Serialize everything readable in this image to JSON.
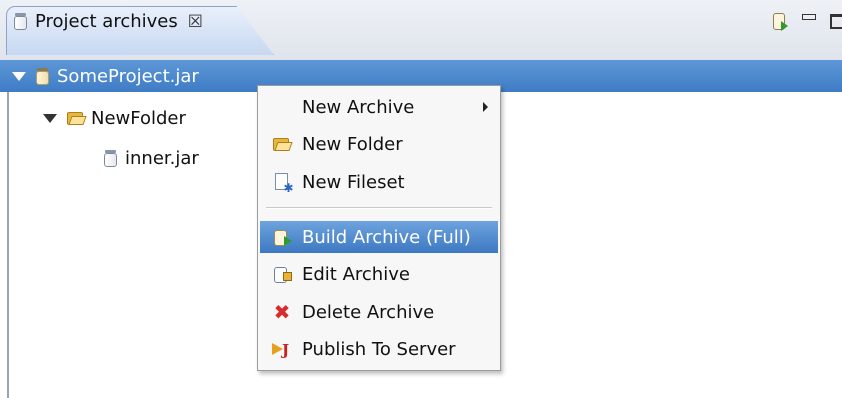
{
  "view": {
    "tab_title": "Project archives",
    "tab_close_glyph": "☒",
    "tab_icon": "jar-icon",
    "toolbar_icons": [
      "build-archive-icon",
      "minimize-icon",
      "maximize-icon"
    ]
  },
  "tree": {
    "root": {
      "label": "SomeProject.jar",
      "expanded": true,
      "selected": true,
      "icon": "jar-icon"
    },
    "folder": {
      "label": "NewFolder",
      "expanded": true,
      "icon": "folder-icon"
    },
    "child": {
      "label": "inner.jar",
      "icon": "jar-icon"
    }
  },
  "menu": {
    "items": [
      {
        "label": "New Archive",
        "has_submenu": true,
        "icon": ""
      },
      {
        "label": "New Folder",
        "icon": "folder-icon"
      },
      {
        "label": "New Fileset",
        "icon": "fileset-icon"
      },
      {
        "label": "Build Archive (Full)",
        "icon": "build-icon",
        "highlighted": true
      },
      {
        "label": "Edit Archive",
        "icon": "edit-icon"
      },
      {
        "label": "Delete Archive",
        "icon": "delete-icon"
      },
      {
        "label": "Publish To Server",
        "icon": "publish-icon"
      }
    ]
  },
  "colors": {
    "selection": "#3f7cc6",
    "menu_highlight": "#4a86cc",
    "menu_bg": "#f7f7f7"
  }
}
